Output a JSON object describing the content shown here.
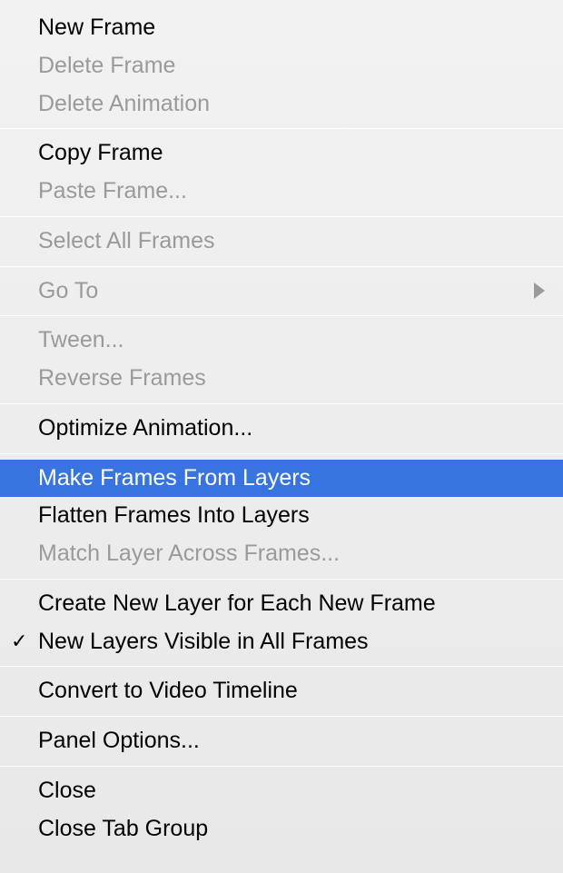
{
  "menu": {
    "newFrame": "New Frame",
    "deleteFrame": "Delete Frame",
    "deleteAnimation": "Delete Animation",
    "copyFrame": "Copy Frame",
    "pasteFrame": "Paste Frame...",
    "selectAllFrames": "Select All Frames",
    "goTo": "Go To",
    "tween": "Tween...",
    "reverseFrames": "Reverse Frames",
    "optimizeAnimation": "Optimize Animation...",
    "makeFramesFromLayers": "Make Frames From Layers",
    "flattenFramesIntoLayers": "Flatten Frames Into Layers",
    "matchLayerAcrossFrames": "Match Layer Across Frames...",
    "createNewLayerForEachNewFrame": "Create New Layer for Each New Frame",
    "newLayersVisibleInAllFrames": "New Layers Visible in All Frames",
    "convertToVideoTimeline": "Convert to Video Timeline",
    "panelOptions": "Panel Options...",
    "close": "Close",
    "closeTabGroup": "Close Tab Group"
  }
}
